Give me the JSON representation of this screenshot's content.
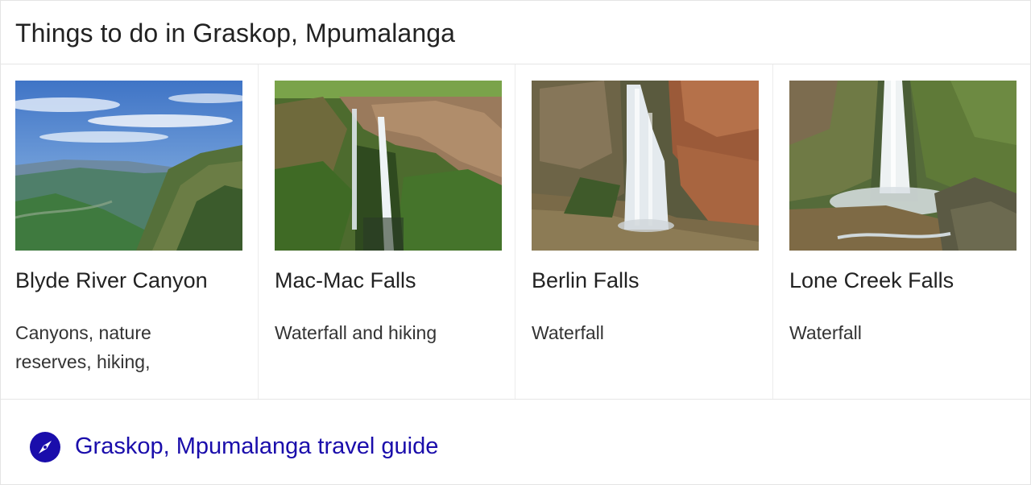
{
  "header": {
    "title": "Things to do in Graskop, Mpumalanga"
  },
  "items": [
    {
      "name": "Blyde River Canyon",
      "description": "Canyons, nature reserves, hiking,"
    },
    {
      "name": "Mac-Mac Falls",
      "description": "Waterfall and hiking"
    },
    {
      "name": "Berlin Falls",
      "description": "Waterfall"
    },
    {
      "name": "Lone Creek Falls",
      "description": "Waterfall"
    }
  ],
  "footer": {
    "link_label": "Graskop, Mpumalanga travel guide",
    "icon": "compass-icon"
  },
  "colors": {
    "link": "#1a0dab",
    "text": "#222222"
  }
}
